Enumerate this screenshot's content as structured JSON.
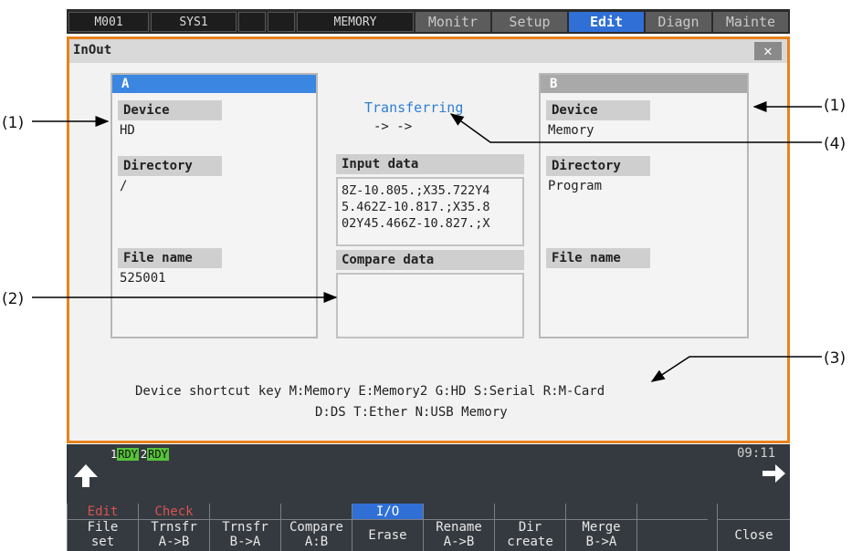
{
  "topbar": {
    "machine": "M001",
    "system": "SYS1",
    "mode": "MEMORY",
    "menus": [
      "Monitr",
      "Setup",
      "Edit",
      "Diagn",
      "Mainte"
    ],
    "active_menu": "Edit"
  },
  "window": {
    "title": "InOut",
    "close_symbol": "✕"
  },
  "panel_a": {
    "header": "A",
    "device_label": "Device",
    "device_value": "HD",
    "directory_label": "Directory",
    "directory_value": "/",
    "filename_label": "File name",
    "filename_value": "525001"
  },
  "panel_b": {
    "header": "B",
    "device_label": "Device",
    "device_value": "Memory",
    "directory_label": "Directory",
    "directory_value": "Program",
    "filename_label": "File name",
    "filename_value": ""
  },
  "transfer": {
    "status": "Transferring",
    "arrows": "-> ->",
    "input_label": "Input data",
    "input_lines": [
      "8Z-10.805.;X35.722Y4",
      "5.462Z-10.817.;X35.8",
      "02Y45.466Z-10.827.;X"
    ],
    "compare_label": "Compare data"
  },
  "shortcut": {
    "line1": "Device shortcut key M:Memory E:Memory2 G:HD S:Serial R:M-Card",
    "line2": "D:DS T:Ether N:USB Memory"
  },
  "status_bar": {
    "sys1_num": "1",
    "sys1_state": "RDY",
    "sys2_num": "2",
    "sys2_state": "RDY",
    "time": "09:11"
  },
  "function_keys": [
    {
      "top": "Edit",
      "label": "File\nset"
    },
    {
      "top": "Check",
      "label": "Trnsfr\nA->B"
    },
    {
      "top": "",
      "label": "Trnsfr\nB->A"
    },
    {
      "top": "",
      "label": "Compare\nA:B"
    },
    {
      "top": "I/O",
      "label": "Erase"
    },
    {
      "top": "",
      "label": "Rename\nA->B"
    },
    {
      "top": "",
      "label": "Dir\ncreate"
    },
    {
      "top": "",
      "label": "Merge\nB->A"
    },
    {
      "top": "",
      "label": ""
    },
    {
      "top": "",
      "label": "Close"
    }
  ],
  "annotations": [
    "(1)",
    "(2)",
    "(3)",
    "(4)",
    "(1)"
  ],
  "colors": {
    "accent": "#e8821e",
    "active_menu": "#2f6fd6",
    "panel_a_header": "#3a86e0",
    "ready_green": "#56c23a",
    "transfer_text": "#2f7fd4"
  }
}
